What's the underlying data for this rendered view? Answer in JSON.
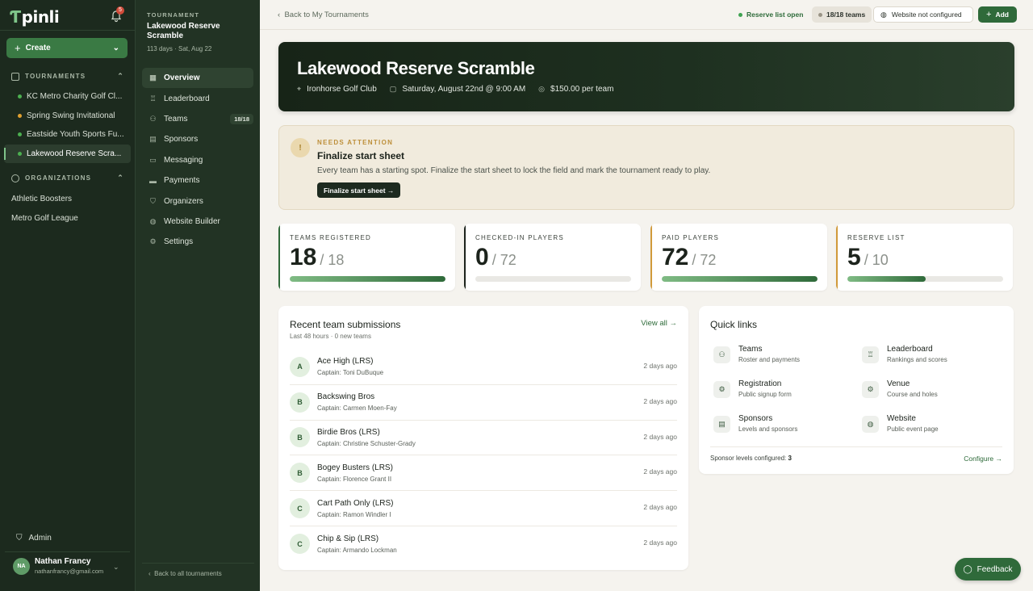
{
  "app": {
    "logo": "pinli",
    "notifications_count": "5"
  },
  "sidebar": {
    "create_label": "Create",
    "tournaments_heading": "TOURNAMENTS",
    "tournaments": [
      {
        "label": "KC Metro Charity Golf Cl...",
        "dot": "#4caf50"
      },
      {
        "label": "Spring Swing Invitational",
        "dot": "#e0a030"
      },
      {
        "label": "Eastside Youth Sports Fu...",
        "dot": "#4caf50"
      },
      {
        "label": "Lakewood Reserve Scra...",
        "dot": "#4caf50",
        "active": true
      }
    ],
    "organizations_heading": "ORGANIZATIONS",
    "organizations": [
      "Athletic Boosters",
      "Metro Golf League"
    ],
    "admin_label": "Admin",
    "user": {
      "initials": "NA",
      "name": "Nathan Francy",
      "email": "nathanfrancy@gmail.com"
    }
  },
  "subnav": {
    "label": "TOURNAMENT",
    "title": "Lakewood Reserve Scramble",
    "meta": "113 days · Sat, Aug 22",
    "items": [
      {
        "label": "Overview",
        "icon": "grid-icon",
        "active": true
      },
      {
        "label": "Leaderboard",
        "icon": "trophy-icon"
      },
      {
        "label": "Teams",
        "icon": "users-icon",
        "badge": "18/18"
      },
      {
        "label": "Sponsors",
        "icon": "building-icon"
      },
      {
        "label": "Messaging",
        "icon": "message-icon"
      },
      {
        "label": "Payments",
        "icon": "card-icon"
      },
      {
        "label": "Organizers",
        "icon": "shield-icon"
      },
      {
        "label": "Website Builder",
        "icon": "globe-icon"
      },
      {
        "label": "Settings",
        "icon": "gear-icon"
      }
    ],
    "back_all": "Back to all tournaments"
  },
  "topbar": {
    "back": "Back to My Tournaments",
    "reserve_status": "Reserve list open",
    "teams_pill": "18/18 teams",
    "website_pill": "Website not configured",
    "add_label": "Add"
  },
  "hero": {
    "title": "Lakewood Reserve Scramble",
    "venue": "Ironhorse Golf Club",
    "date": "Saturday, August 22nd @ 9:00 AM",
    "price": "$150.00 per team"
  },
  "attention": {
    "label": "NEEDS ATTENTION",
    "title": "Finalize start sheet",
    "desc": "Every team has a starting spot. Finalize the start sheet to lock the field and mark the tournament ready to play.",
    "button": "Finalize start sheet →"
  },
  "stats": [
    {
      "label": "TEAMS REGISTERED",
      "value": "18",
      "total": "/ 18",
      "fraction": 1.0,
      "edge": "#2f6a3a"
    },
    {
      "label": "CHECKED-IN PLAYERS",
      "value": "0",
      "total": "/ 72",
      "fraction": 0.0,
      "edge": "#1c231c"
    },
    {
      "label": "PAID PLAYERS",
      "value": "72",
      "total": "/ 72",
      "fraction": 1.0,
      "edge": "#d19a3a"
    },
    {
      "label": "RESERVE LIST",
      "value": "5",
      "total": "/ 10",
      "fraction": 0.5,
      "edge": "#d19a3a"
    }
  ],
  "recent": {
    "title": "Recent team submissions",
    "subtitle": "Last 48 hours · 0 new teams",
    "view_all": "View all →",
    "rows": [
      {
        "initial": "A",
        "name": "Ace High (LRS)",
        "captain": "Captain: Toni DuBuque",
        "time": "2 days ago"
      },
      {
        "initial": "B",
        "name": "Backswing Bros",
        "captain": "Captain: Carmen Moen-Fay",
        "time": "2 days ago"
      },
      {
        "initial": "B",
        "name": "Birdie Bros (LRS)",
        "captain": "Captain: Christine Schuster-Grady",
        "time": "2 days ago"
      },
      {
        "initial": "B",
        "name": "Bogey Busters (LRS)",
        "captain": "Captain: Florence Grant II",
        "time": "2 days ago"
      },
      {
        "initial": "C",
        "name": "Cart Path Only (LRS)",
        "captain": "Captain: Ramon Windler I",
        "time": "2 days ago"
      },
      {
        "initial": "C",
        "name": "Chip & Sip (LRS)",
        "captain": "Captain: Armando Lockman",
        "time": "2 days ago"
      }
    ]
  },
  "quick_links": {
    "title": "Quick links",
    "items": [
      {
        "name": "Teams",
        "desc": "Roster and payments",
        "icon": "users-icon"
      },
      {
        "name": "Leaderboard",
        "desc": "Rankings and scores",
        "icon": "trophy-icon"
      },
      {
        "name": "Registration",
        "desc": "Public signup form",
        "icon": "gear-icon"
      },
      {
        "name": "Venue",
        "desc": "Course and holes",
        "icon": "gear-icon"
      },
      {
        "name": "Sponsors",
        "desc": "Levels and sponsors",
        "icon": "building-icon"
      },
      {
        "name": "Website",
        "desc": "Public event page",
        "icon": "globe-icon"
      }
    ],
    "footer_label": "Sponsor levels configured:",
    "footer_value": "3",
    "configure": "Configure →"
  },
  "feedback_label": "Feedback"
}
